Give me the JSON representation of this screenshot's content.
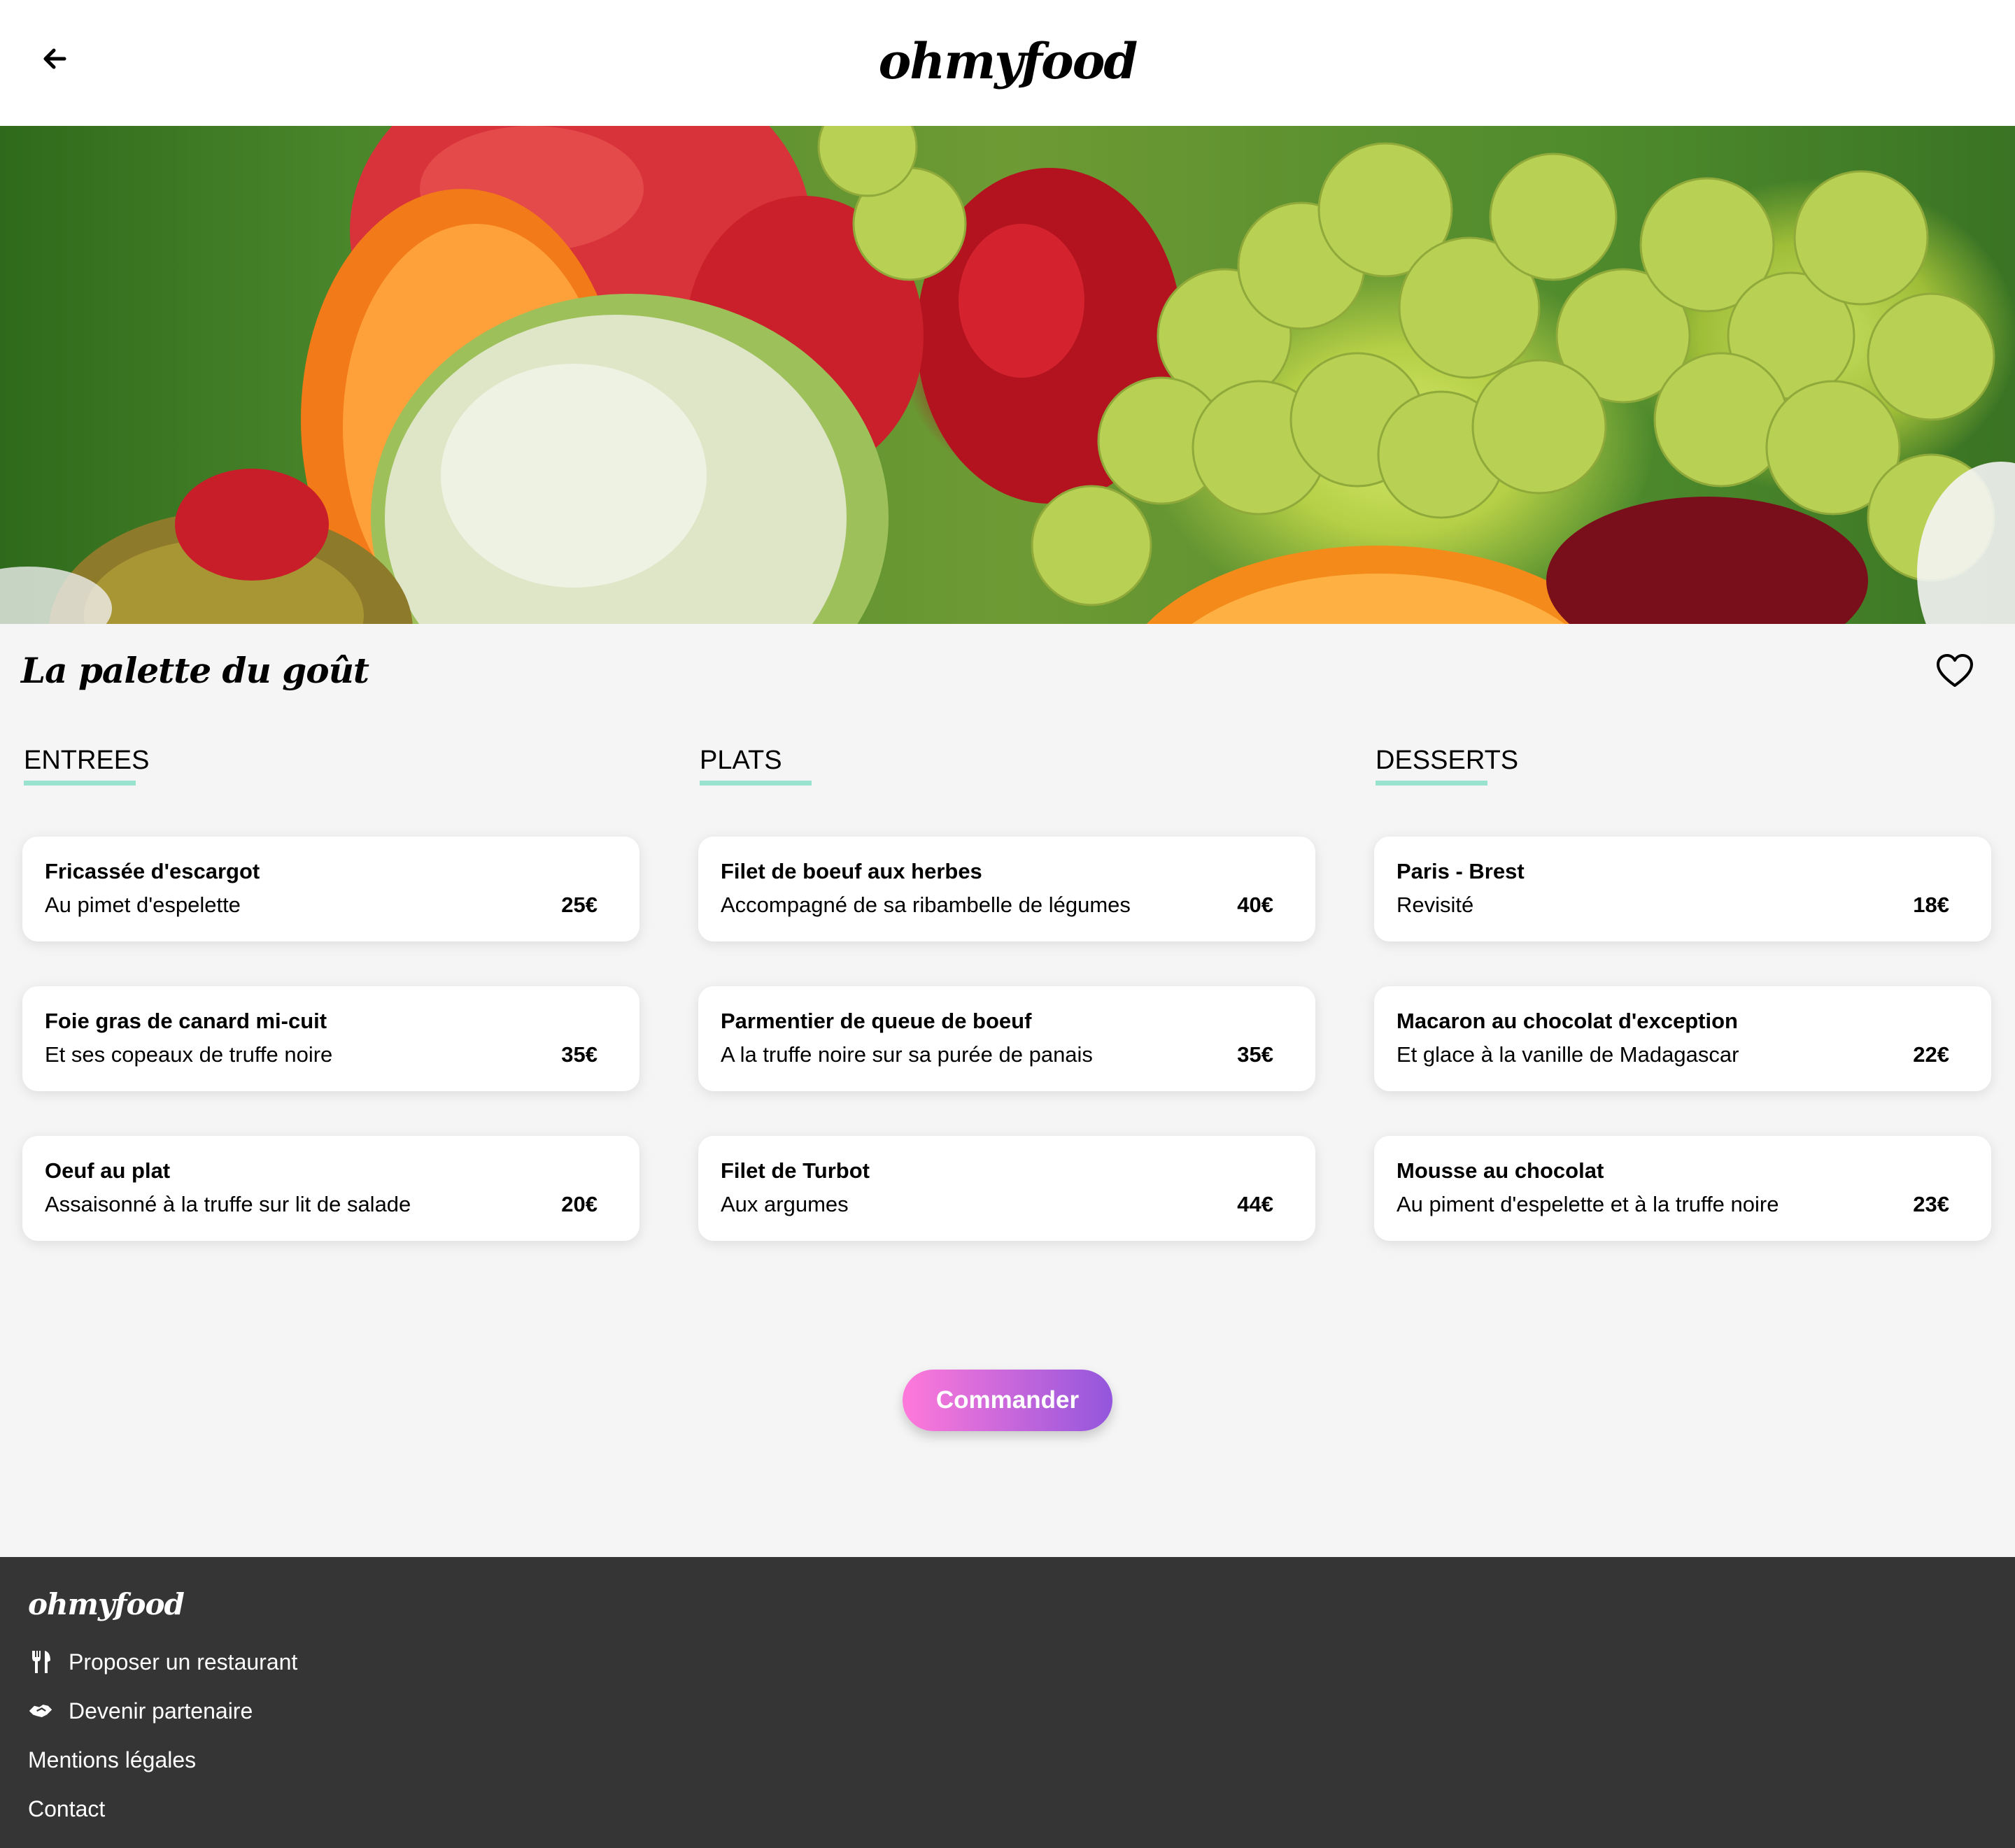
{
  "header": {
    "logo": "ohmyfood"
  },
  "hero": {
    "alt": "fruits"
  },
  "restaurant": {
    "name": "La palette du goût"
  },
  "menu": {
    "entrees": {
      "heading": "ENTREES",
      "items": [
        {
          "name": "Fricassée d'escargot",
          "desc": "Au pimet d'espelette",
          "price": "25€"
        },
        {
          "name": "Foie gras de canard mi-cuit",
          "desc": "Et ses copeaux de truffe noire",
          "price": "35€"
        },
        {
          "name": "Oeuf au plat",
          "desc": "Assaisonné à la truffe sur lit de salade",
          "price": "20€"
        }
      ]
    },
    "plats": {
      "heading": "PLATS",
      "items": [
        {
          "name": "Filet de boeuf aux herbes",
          "desc": "Accompagné de sa ribambelle de légumes",
          "price": "40€"
        },
        {
          "name": "Parmentier de queue de boeuf",
          "desc": "A la truffe noire sur sa purée de panais",
          "price": "35€"
        },
        {
          "name": "Filet de Turbot",
          "desc": "Aux argumes",
          "price": "44€"
        }
      ]
    },
    "desserts": {
      "heading": "DESSERTS",
      "items": [
        {
          "name": "Paris - Brest",
          "desc": "Revisité",
          "price": "18€"
        },
        {
          "name": "Macaron au chocolat d'exception",
          "desc": "Et glace à la vanille de Madagascar",
          "price": "22€"
        },
        {
          "name": "Mousse au chocolat",
          "desc": "Au piment d'espelette et à la truffe noire",
          "price": "23€"
        }
      ]
    }
  },
  "order_button": "Commander",
  "footer": {
    "logo": "ohmyfood",
    "links": [
      {
        "label": "Proposer un restaurant",
        "icon": "utensils-icon"
      },
      {
        "label": "Devenir partenaire",
        "icon": "handshake-icon"
      },
      {
        "label": "Mentions légales"
      },
      {
        "label": "Contact"
      }
    ]
  },
  "colors": {
    "accent": "#99e2d0",
    "button_gradient_start": "#ff79da",
    "button_gradient_end": "#9356dc",
    "footer_bg": "#353535",
    "page_bg": "#f5f5f5"
  }
}
